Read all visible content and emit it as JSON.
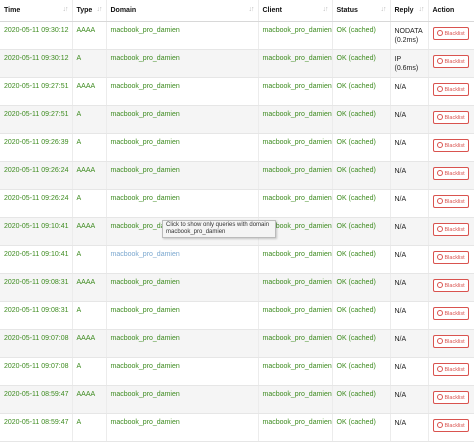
{
  "columns": [
    "Time",
    "Type",
    "Domain",
    "Client",
    "Status",
    "Reply",
    "Action"
  ],
  "rows": [
    {
      "time": "2020-05-11 09:30:12",
      "type": "AAAA",
      "domain": "macbook_pro_damien",
      "client": "macbook_pro_damien",
      "status": "OK (cached)",
      "reply": "NODATA (0.2ms)"
    },
    {
      "time": "2020-05-11 09:30:12",
      "type": "A",
      "domain": "macbook_pro_damien",
      "client": "macbook_pro_damien",
      "status": "OK (cached)",
      "reply": "IP (0.6ms)"
    },
    {
      "time": "2020-05-11 09:27:51",
      "type": "AAAA",
      "domain": "macbook_pro_damien",
      "client": "macbook_pro_damien",
      "status": "OK (cached)",
      "reply": "N/A"
    },
    {
      "time": "2020-05-11 09:27:51",
      "type": "A",
      "domain": "macbook_pro_damien",
      "client": "macbook_pro_damien",
      "status": "OK (cached)",
      "reply": "N/A"
    },
    {
      "time": "2020-05-11 09:26:39",
      "type": "A",
      "domain": "macbook_pro_damien",
      "client": "macbook_pro_damien",
      "status": "OK (cached)",
      "reply": "N/A"
    },
    {
      "time": "2020-05-11 09:26:24",
      "type": "AAAA",
      "domain": "macbook_pro_damien",
      "client": "macbook_pro_damien",
      "status": "OK (cached)",
      "reply": "N/A"
    },
    {
      "time": "2020-05-11 09:26:24",
      "type": "A",
      "domain": "macbook_pro_damien",
      "client": "macbook_pro_damien",
      "status": "OK (cached)",
      "reply": "N/A"
    },
    {
      "time": "2020-05-11 09:10:41",
      "type": "AAAA",
      "domain": "macbook_pro_damien",
      "client": "macbook_pro_damien",
      "status": "OK (cached)",
      "reply": "N/A"
    },
    {
      "time": "2020-05-11 09:10:41",
      "type": "A",
      "domain": "macbook_pro_damien",
      "client": "macbook_pro_damien",
      "status": "OK (cached)",
      "reply": "N/A"
    },
    {
      "time": "2020-05-11 09:08:31",
      "type": "AAAA",
      "domain": "macbook_pro_damien",
      "client": "macbook_pro_damien",
      "status": "OK (cached)",
      "reply": "N/A"
    },
    {
      "time": "2020-05-11 09:08:31",
      "type": "A",
      "domain": "macbook_pro_damien",
      "client": "macbook_pro_damien",
      "status": "OK (cached)",
      "reply": "N/A"
    },
    {
      "time": "2020-05-11 09:07:08",
      "type": "AAAA",
      "domain": "macbook_pro_damien",
      "client": "macbook_pro_damien",
      "status": "OK (cached)",
      "reply": "N/A"
    },
    {
      "time": "2020-05-11 09:07:08",
      "type": "A",
      "domain": "macbook_pro_damien",
      "client": "macbook_pro_damien",
      "status": "OK (cached)",
      "reply": "N/A"
    },
    {
      "time": "2020-05-11 08:59:47",
      "type": "AAAA",
      "domain": "macbook_pro_damien",
      "client": "macbook_pro_damien",
      "status": "OK (cached)",
      "reply": "N/A"
    },
    {
      "time": "2020-05-11 08:59:47",
      "type": "A",
      "domain": "macbook_pro_damien",
      "client": "macbook_pro_damien",
      "status": "OK (cached)",
      "reply": "N/A"
    }
  ],
  "blacklist_label": "Blacklist",
  "tooltip": "Click to show only queries with domain macbook_pro_damien",
  "colors": {
    "ok_text": "#3d8b1f",
    "blacklist": "#d9534f",
    "hover_link": "#7aa7cf"
  },
  "icons": {
    "sort": "sort-arrows-icon",
    "blacklist": "ban-icon"
  }
}
